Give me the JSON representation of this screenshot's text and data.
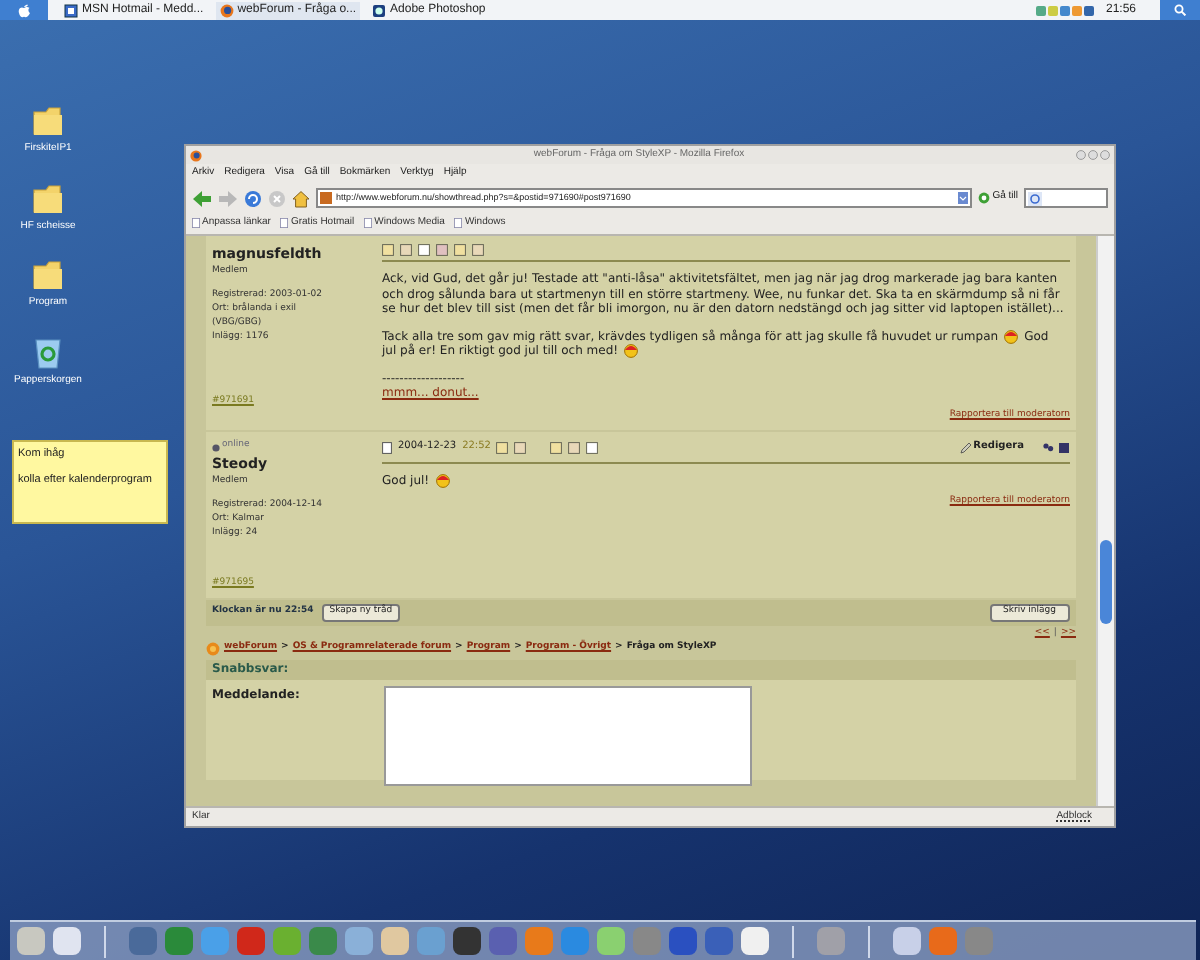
{
  "taskbar": {
    "apps": [
      {
        "title": "MSN Hotmail - Medd...",
        "kind": "mail",
        "selected": false
      },
      {
        "title": "webForum - Fråga o...",
        "kind": "firefox",
        "selected": true
      },
      {
        "title": "Adobe Photoshop",
        "kind": "photoshop",
        "selected": false
      }
    ],
    "clock": "21:56"
  },
  "desktop_icons": [
    {
      "label": "FirskiteIP1",
      "kind": "folder"
    },
    {
      "label": "HF scheisse",
      "kind": "folder"
    },
    {
      "label": "Program",
      "kind": "folder"
    },
    {
      "label": "Papperskorgen",
      "kind": "trash"
    }
  ],
  "sticky_note": {
    "lines": [
      "Kom ihåg",
      "kolla efter kalenderprogram"
    ]
  },
  "browser": {
    "title": "webForum - Fråga om StyleXP - Mozilla Firefox",
    "menu": [
      "Arkiv",
      "Redigera",
      "Visa",
      "Gå till",
      "Bokmärken",
      "Verktyg",
      "Hjälp"
    ],
    "url": "http://www.webforum.nu/showthread.php?s=&postid=971690#post971690",
    "go_button": "Gå till",
    "bookmarks": [
      "Anpassa länkar",
      "Gratis Hotmail",
      "Windows Media",
      "Windows"
    ],
    "status": "Klar",
    "status_right": "Adblock"
  },
  "posts": [
    {
      "username": "magnusfeldth",
      "rank": "Medlem",
      "info": [
        "Registrerad: 2003-01-02",
        "Ort: brålanda i exil (VBG/GBG)",
        "Inlägg: 1176"
      ],
      "post_link": "#971691",
      "paragraphs": [
        {
          "lines": [
            [
              {
                "kind": "text",
                "text": "Ack, vid Gud, det går ju! Testade att \"anti-låsa\" aktivitetsfältet, men jag när jag drog markerade jag bara kanten och drog sålunda bara ut startmenyn till en större startmeny. Wee, nu funkar det. Ska ta en skärmdump så ni får se hur det blev till sist (men det får bli imorgon, nu är den datorn nedstängd och jag sitter vid laptopen istället)..."
              }
            ]
          ]
        },
        {
          "lines": [
            [
              {
                "kind": "text",
                "text": "Tack alla tre som gav mig rätt svar, krävdes tydligen så många för att jag skulle få huvudet ur rumpan"
              },
              {
                "kind": "smiley"
              },
              {
                "kind": "text",
                "text": "God"
              }
            ],
            [
              {
                "kind": "text",
                "text": "jul på er! En riktigt god jul till och med!"
              },
              {
                "kind": "smiley"
              }
            ]
          ]
        }
      ],
      "signature_rule": "-------------------",
      "signature": "mmm... donut...",
      "report": "Rapportera till moderatorn"
    },
    {
      "online": "online",
      "username": "Steody",
      "rank": "Medlem",
      "date": "2004-12-23",
      "time": "22:52",
      "edit": "Redigera",
      "info": [
        "Registrerad: 2004-12-14",
        "Ort: Kalmar",
        "Inlägg: 24"
      ],
      "post_link": "#971695",
      "paragraphs": [
        {
          "lines": [
            [
              {
                "kind": "text",
                "text": "God jul!"
              },
              {
                "kind": "smiley"
              }
            ]
          ]
        }
      ],
      "report": "Rapportera till moderatorn"
    }
  ],
  "footer": {
    "clock_text": "Klockan är nu 22:54",
    "new_thread": "Skapa ny tråd",
    "reply": "Skriv inlägg",
    "pager": [
      "<<",
      "|",
      ">>"
    ]
  },
  "breadcrumb_separator": ">",
  "breadcrumb": [
    "webForum",
    "OS & Programrelaterade forum",
    "Program",
    "Program - Övrigt",
    "Fråga om StyleXP"
  ],
  "quick_reply": {
    "title": "Snabbsvar:",
    "label": "Meddelande:"
  }
}
